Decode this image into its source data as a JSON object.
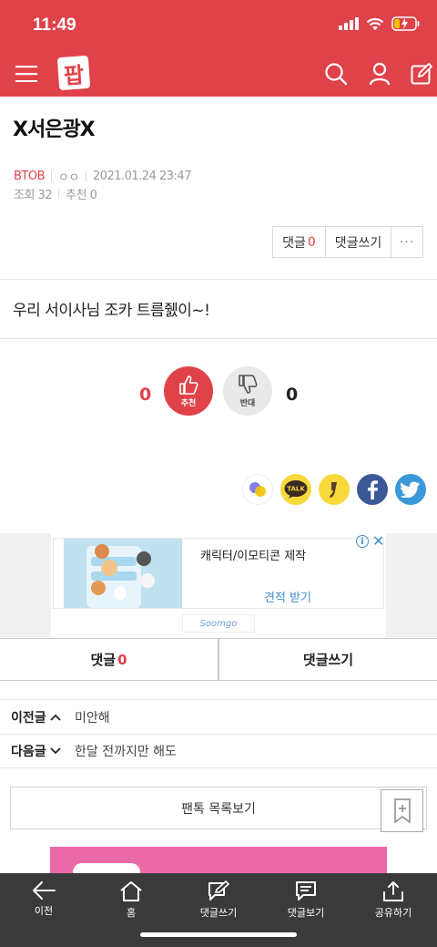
{
  "status": {
    "time": "11:49"
  },
  "header": {
    "logo_text": "팝"
  },
  "post": {
    "title": "X서은광X",
    "category": "BTOB",
    "author": "ㅇㅇ",
    "datetime": "2021.01.24 23:47",
    "views": "조회 32",
    "recommends": "추천 0",
    "body": "우리 서이사님 조카 트름쥀이~!"
  },
  "top_actions": {
    "comment_label": "댓글",
    "comment_count": "0",
    "write_comment": "댓글쓰기",
    "more": "···"
  },
  "vote": {
    "up_count": "0",
    "up_label": "추천",
    "down_label": "반대",
    "down_count": "0"
  },
  "share": {
    "kakaotalk_label": "TALK"
  },
  "ad": {
    "title": "캐릭터/이모티콘 제작",
    "cta": "견적 받기",
    "brand": "Soomgo",
    "info": "i",
    "close": "✕"
  },
  "comment_tabs": {
    "comments_label": "댓글",
    "comments_count": "0",
    "write_label": "댓글쓰기"
  },
  "nav": {
    "prev_label": "이전글",
    "prev_title": "미안해",
    "next_label": "다음글",
    "next_title": "한달 전까지만 해도"
  },
  "list_button": "팬톡 목록보기",
  "tabbar": {
    "items": [
      {
        "label": "이전",
        "icon": "arrow-left-icon"
      },
      {
        "label": "홈",
        "icon": "home-icon"
      },
      {
        "label": "댓글쓰기",
        "icon": "write-comment-icon"
      },
      {
        "label": "댓글보기",
        "icon": "view-comments-icon"
      },
      {
        "label": "공유하기",
        "icon": "share-icon"
      }
    ]
  },
  "colors": {
    "brand": "#e0424a",
    "tabbar": "#3a3a3a",
    "facebook": "#3b5998",
    "twitter": "#3b98d8",
    "kakao": "#f7d93c"
  }
}
